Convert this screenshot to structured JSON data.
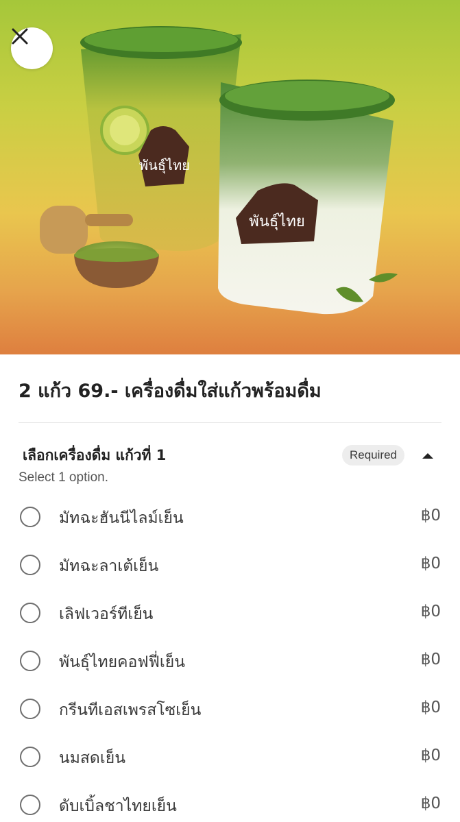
{
  "header": {
    "close_icon": "close-icon"
  },
  "item": {
    "title": "2 แก้ว 69.- เครื่องดื่มใส่แก้วพร้อมดื่ม"
  },
  "option_group": {
    "title": "เลือกเครื่องดื่ม แก้วที่ 1",
    "required_label": "Required",
    "subtitle": "Select 1 option.",
    "toggle_icon": "caret-up-icon",
    "options": [
      {
        "label": "มัทฉะฮันนีไลม์เย็น",
        "price": "฿0",
        "selected": false
      },
      {
        "label": "มัทฉะลาเต้เย็น",
        "price": "฿0",
        "selected": false
      },
      {
        "label": "เลิฟเวอร์ทีเย็น",
        "price": "฿0",
        "selected": false
      },
      {
        "label": "พันธุ์ไทยคอฟฟี่เย็น",
        "price": "฿0",
        "selected": false
      },
      {
        "label": "กรีนทีเอสเพรสโซเย็น",
        "price": "฿0",
        "selected": false
      },
      {
        "label": "นมสดเย็น",
        "price": "฿0",
        "selected": false
      },
      {
        "label": "ดับเบิ้ลชาไทยเย็น",
        "price": "฿0",
        "selected": false
      }
    ]
  },
  "colors": {
    "hero_top": "#a5c73a",
    "hero_bottom": "#de7f3f",
    "badge_bg": "#ededed",
    "radio_border": "#6e6e6e"
  }
}
